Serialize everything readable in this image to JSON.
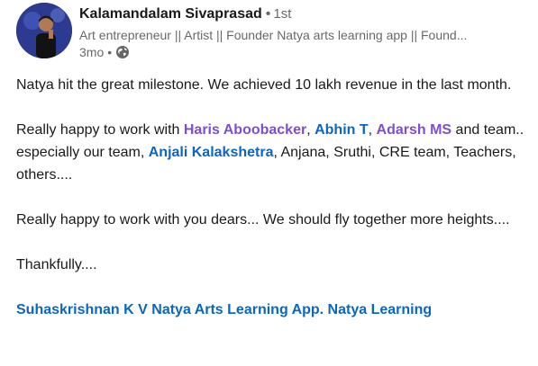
{
  "author": {
    "name": "Kalamandalam Sivaprasad",
    "degree": "1st",
    "headline": "Art entrepreneur || Artist || Founder Natya arts learning app || Found...",
    "time": "3mo",
    "visibility_icon": "globe-icon"
  },
  "post": {
    "line1": "Natya hit the great milestone. We achieved 10 lakh revenue in the last month.",
    "p2_start": "Really happy to work with ",
    "mention1": "Haris Aboobacker",
    "comma1": ", ",
    "mention2": "Abhin T",
    "comma2": ", ",
    "mention3": "Adarsh MS",
    "p2_mid": " and team.. especially our team, ",
    "mention4": "Anjali Kalakshetra",
    "p2_end": ", Anjana, Sruthi, CRE team, Teachers, others....",
    "p3": "Really happy to work with you dears... We should fly together more heights....",
    "p4": "Thankfully....",
    "tags": "Suhaskrishnan K V Natya Arts Learning App. Natya Learning"
  },
  "colors": {
    "mention_purple": "#7a4fd0",
    "mention_blue": "#0a66c2"
  }
}
